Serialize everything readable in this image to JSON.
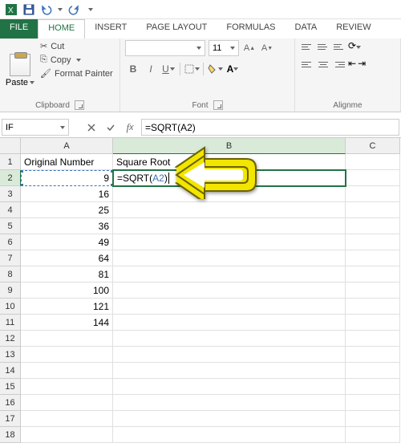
{
  "qat": {
    "save": "save-icon",
    "undo": "undo-icon",
    "redo": "redo-icon"
  },
  "tabs": {
    "file": "FILE",
    "home": "HOME",
    "insert": "INSERT",
    "page_layout": "PAGE LAYOUT",
    "formulas": "FORMULAS",
    "data": "DATA",
    "review": "REVIEW"
  },
  "ribbon": {
    "clipboard": {
      "paste": "Paste",
      "cut": "Cut",
      "copy": "Copy",
      "format_painter": "Format Painter",
      "title": "Clipboard"
    },
    "font": {
      "family_placeholder": "",
      "size": "11",
      "title": "Font",
      "bold": "B",
      "italic": "I",
      "underline": "U"
    },
    "alignment": {
      "title": "Alignme"
    }
  },
  "formula_bar": {
    "name_box": "IF",
    "formula": "=SQRT(A2)",
    "formula_prefix": "=SQRT(",
    "formula_ref": "A2",
    "formula_suffix": ")"
  },
  "columns": [
    "A",
    "B",
    "C"
  ],
  "headers": {
    "A": "Original Number",
    "B": "Square Root"
  },
  "rows": [
    {
      "n": 1,
      "A": "Original Number",
      "B": "Square Root"
    },
    {
      "n": 2,
      "A": "9",
      "B_edit": true
    },
    {
      "n": 3,
      "A": "16"
    },
    {
      "n": 4,
      "A": "25"
    },
    {
      "n": 5,
      "A": "36"
    },
    {
      "n": 6,
      "A": "49"
    },
    {
      "n": 7,
      "A": "64"
    },
    {
      "n": 8,
      "A": "81"
    },
    {
      "n": 9,
      "A": "100"
    },
    {
      "n": 10,
      "A": "121"
    },
    {
      "n": 11,
      "A": "144"
    },
    {
      "n": 12
    },
    {
      "n": 13
    },
    {
      "n": 14
    },
    {
      "n": 15
    },
    {
      "n": 16
    },
    {
      "n": 17
    },
    {
      "n": 18
    }
  ],
  "colors": {
    "accent": "#217346",
    "ref": "#3b73b9",
    "arrow": "#f2e500"
  }
}
